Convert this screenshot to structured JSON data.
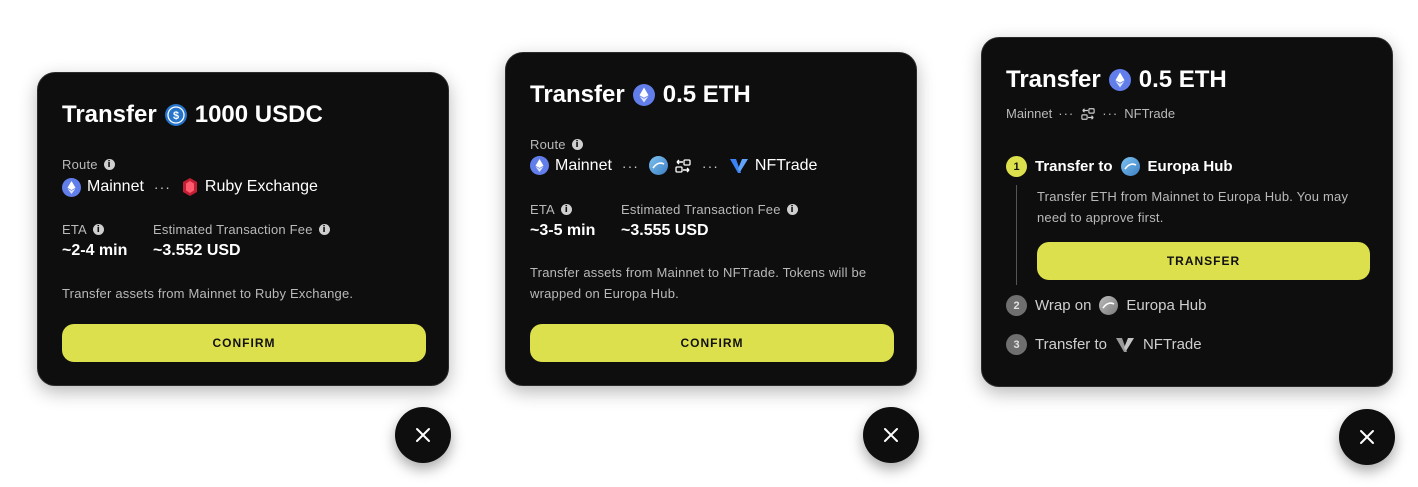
{
  "colors": {
    "card_bg": "#0e0e0e",
    "accent": "#dde04d",
    "eth": "#627eea",
    "usdc": "#2775ca",
    "ruby": "#d4213a"
  },
  "card1": {
    "title_prefix": "Transfer",
    "amount": "1000 USDC",
    "token_icon": "usdc-icon",
    "route_label": "Route",
    "route_from": "Mainnet",
    "route_dots": "···",
    "route_to": "Ruby Exchange",
    "eta_label": "ETA",
    "eta_value": "~2-4 min",
    "fee_label": "Estimated Transaction Fee",
    "fee_value": "~3.552 USD",
    "description": "Transfer assets from Mainnet to Ruby Exchange.",
    "confirm_label": "CONFIRM"
  },
  "card2": {
    "title_prefix": "Transfer",
    "amount": "0.5 ETH",
    "token_icon": "eth-icon",
    "route_label": "Route",
    "route_from": "Mainnet",
    "route_dots": "···",
    "route_to": "NFTrade",
    "eta_label": "ETA",
    "eta_value": "~3-5 min",
    "fee_label": "Estimated Transaction Fee",
    "fee_value": "~3.555 USD",
    "description": "Transfer assets from Mainnet to NFTrade. Tokens will be wrapped on Europa Hub.",
    "confirm_label": "CONFIRM"
  },
  "card3": {
    "title_prefix": "Transfer",
    "amount": "0.5 ETH",
    "route_from": "Mainnet",
    "route_dots": "···",
    "route_to": "NFTrade",
    "steps": [
      {
        "num": "1",
        "prefix": "Transfer to",
        "target": "Europa Hub"
      },
      {
        "num": "2",
        "prefix": "Wrap on",
        "target": "Europa Hub"
      },
      {
        "num": "3",
        "prefix": "Transfer to",
        "target": "NFTrade"
      }
    ],
    "step1_description": "Transfer ETH from Mainnet to Europa Hub. You may need to approve first.",
    "transfer_label": "TRANSFER"
  },
  "close_icon": "close-icon"
}
